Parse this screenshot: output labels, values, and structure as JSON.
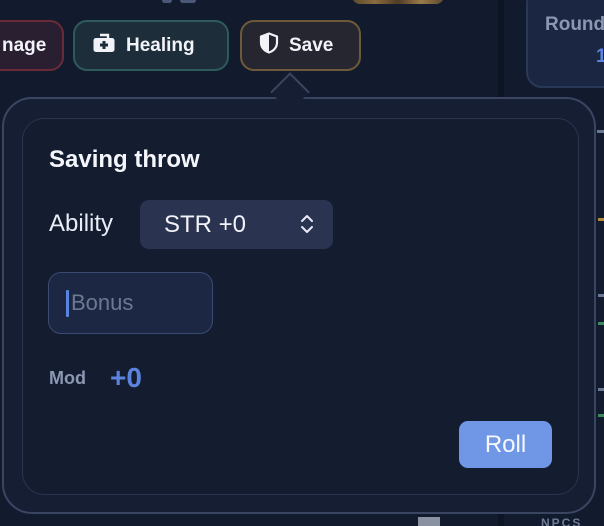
{
  "action_chips": {
    "damage_label": "nage",
    "healing_label": "Healing",
    "save_label": "Save"
  },
  "round_card": {
    "label": "Round",
    "value": "1"
  },
  "side_panel": {
    "npcs_label": "NPCS"
  },
  "saving_throw_popover": {
    "title": "Saving throw",
    "ability_label": "Ability",
    "ability_selected": "STR +0",
    "bonus_placeholder": "Bonus",
    "bonus_value": "",
    "mod_label": "Mod",
    "mod_value": "+0",
    "roll_label": "Roll"
  },
  "colors": {
    "accent": "#5b84de",
    "roll_button": "#6f97e6",
    "popover_bg": "#151e33",
    "select_bg": "#2a3350"
  },
  "icons": {
    "healing": "first-aid-kit-icon",
    "save": "shield-icon",
    "ability_select": "chevron-up-down-icon"
  }
}
